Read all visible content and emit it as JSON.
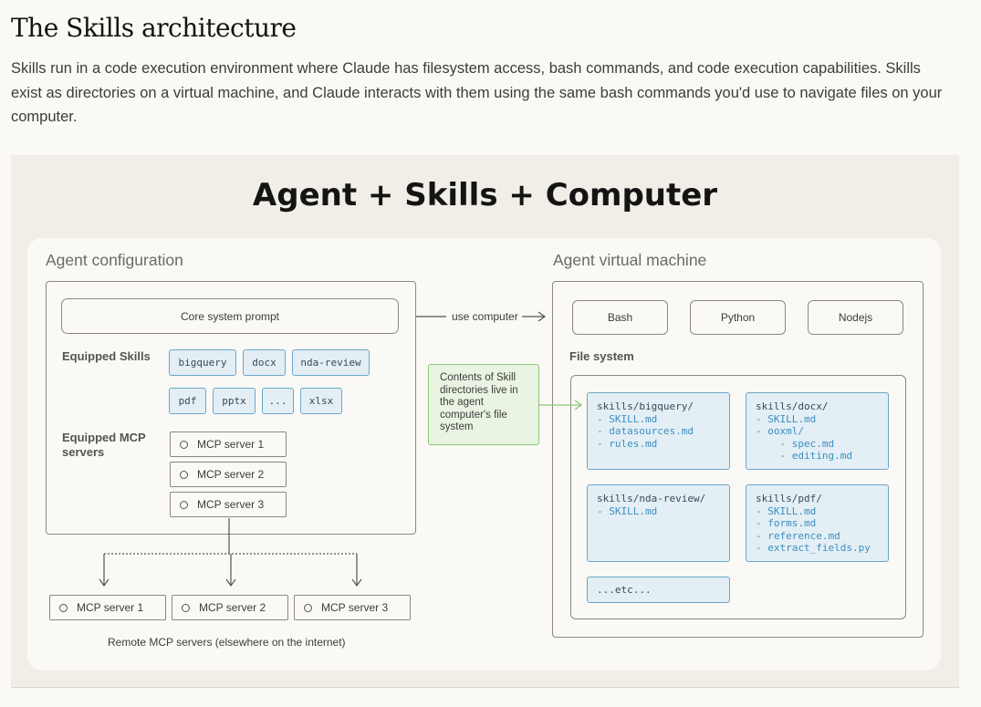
{
  "article": {
    "heading": "The Skills architecture",
    "intro": "Skills run in a code execution environment where Claude has filesystem access, bash commands, and code execution capabilities. Skills exist as directories on a virtual machine, and Claude interacts with them using the same bash commands you'd use to navigate files on your computer."
  },
  "diagram": {
    "title": "Agent + Skills + Computer",
    "agent_config": {
      "label": "Agent configuration",
      "core_prompt": "Core system prompt",
      "skills_label": "Equipped Skills",
      "skills": [
        "bigquery",
        "docx",
        "nda-review",
        "pdf",
        "pptx",
        "...",
        "xlsx"
      ],
      "mcp_label": "Equipped MCP servers",
      "mcp_servers": [
        "MCP server 1",
        "MCP server 2",
        "MCP server 3"
      ]
    },
    "use_computer": "use computer",
    "remote": {
      "servers": [
        "MCP server 1",
        "MCP server 2",
        "MCP server 3"
      ],
      "caption": "Remote MCP servers (elsewhere on the internet)"
    },
    "note": "Contents of Skill directories live in the agent computer's file system",
    "vm": {
      "label": "Agent virtual machine",
      "runtimes": [
        "Bash",
        "Python",
        "Nodejs"
      ],
      "fs_label": "File system",
      "dirs": [
        {
          "name": "skills/bigquery/",
          "files": [
            "- SKILL.md",
            "- datasources.md",
            "- rules.md"
          ]
        },
        {
          "name": "skills/docx/",
          "files": [
            "- SKILL.md",
            "- ooxml/",
            "    - spec.md",
            "    - editing.md"
          ]
        },
        {
          "name": "skills/nda-review/",
          "files": [
            "- SKILL.md"
          ]
        },
        {
          "name": "skills/pdf/",
          "files": [
            "- SKILL.md",
            "- forms.md",
            "- reference.md",
            "- extract_fields.py"
          ]
        }
      ],
      "etc": "...etc..."
    }
  }
}
